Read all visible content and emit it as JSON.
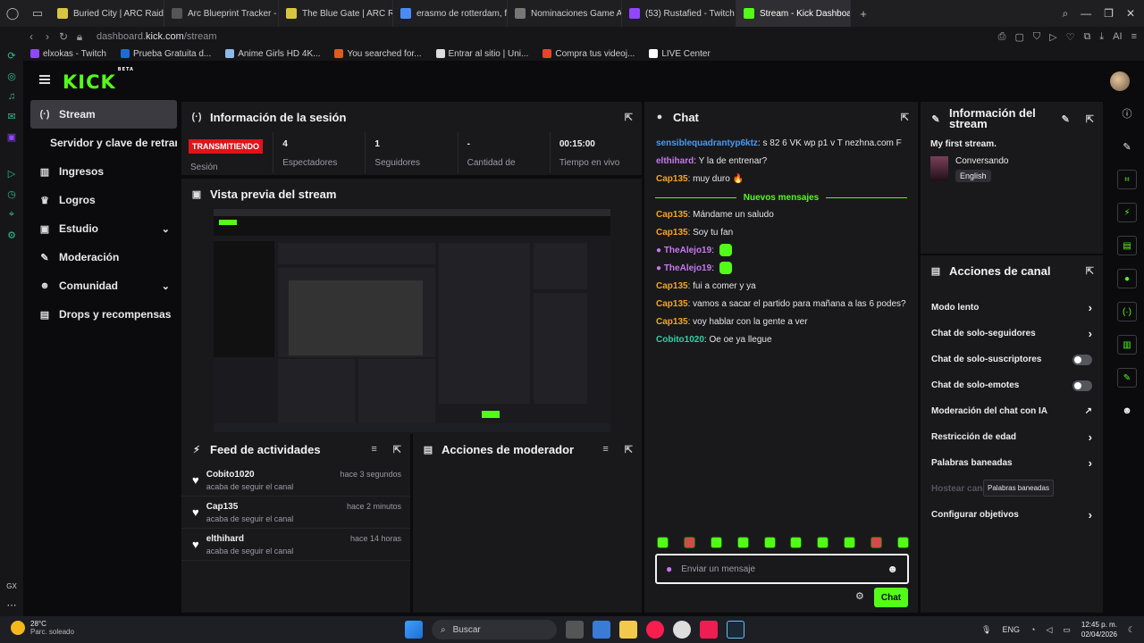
{
  "browser": {
    "tabs": [
      {
        "label": "Buried City | ARC Raiders",
        "color": "#d9c441"
      },
      {
        "label": "Arc Blueprint Tracker - Tra",
        "color": "#555"
      },
      {
        "label": "The Blue Gate | ARC Raide",
        "color": "#d9c441"
      },
      {
        "label": "erasmo de rotterdam, fras",
        "color": "#4a8cf5"
      },
      {
        "label": "Nominaciones Game Awa",
        "color": "#777"
      },
      {
        "label": "(53) Rustafied - Twitch",
        "color": "#9146ff"
      },
      {
        "label": "Stream - Kick Dashboard",
        "color": "#53fc18"
      }
    ],
    "url_prefix": "dashboard.",
    "url_domain": "kick.com",
    "url_path": "/stream",
    "bookmarks": [
      {
        "label": "elxokas - Twitch",
        "color": "#9146ff"
      },
      {
        "label": "Prueba Gratuita d...",
        "color": "#1c6bd9"
      },
      {
        "label": "Anime Girls HD 4K...",
        "color": "#8fb9e8"
      },
      {
        "label": "You searched for...",
        "color": "#e05a1f"
      },
      {
        "label": "Entrar al sitio | Uni...",
        "color": "#ddd"
      },
      {
        "label": "Compra tus videoj...",
        "color": "#e9432c"
      },
      {
        "label": "LIVE Center",
        "color": "#fff"
      }
    ]
  },
  "app": {
    "logo": "KICK",
    "logo_badge": "BETA",
    "nav": [
      {
        "label": "Stream",
        "icon": "broadcast-icon",
        "glyph": "(·)"
      },
      {
        "label": "Servidor y clave de retransmisión",
        "icon": "",
        "glyph": ""
      },
      {
        "label": "Ingresos",
        "icon": "chart-icon",
        "glyph": "▥"
      },
      {
        "label": "Logros",
        "icon": "trophy-icon",
        "glyph": "♛"
      },
      {
        "label": "Estudio",
        "icon": "studio-icon",
        "glyph": "▣"
      },
      {
        "label": "Moderación",
        "icon": "wrench-icon",
        "glyph": "✎"
      },
      {
        "label": "Comunidad",
        "icon": "people-icon",
        "glyph": "☻"
      },
      {
        "label": "Drops y recompensas",
        "icon": "gift-icon",
        "glyph": "▤"
      }
    ]
  },
  "session": {
    "title": "Información de la sesión",
    "live_badge": "TRANSMITIENDO",
    "stats": [
      {
        "value": "",
        "label": "Sesión"
      },
      {
        "value": "4",
        "label": "Espectadores"
      },
      {
        "value": "1",
        "label": "Seguidores"
      },
      {
        "value": "-",
        "label": "Cantidad de"
      },
      {
        "value": "00:15:00",
        "label": "Tiempo en vivo"
      }
    ]
  },
  "preview": {
    "title": "Vista previa del stream"
  },
  "feed": {
    "title": "Feed de actividades",
    "items": [
      {
        "name": "Cobito1020",
        "sub": "acaba de seguir el canal",
        "time": "hace 3 segundos"
      },
      {
        "name": "Cap135",
        "sub": "acaba de seguir el canal",
        "time": "hace 2 minutos"
      },
      {
        "name": "elthihard",
        "sub": "acaba de seguir el canal",
        "time": "hace 14 horas"
      }
    ]
  },
  "moderator": {
    "title": "Acciones de moderador"
  },
  "chat": {
    "title": "Chat",
    "messages_before": [
      {
        "user": "sensiblequadrantyp6ktz",
        "text": ": s 82 6 VK wp p1 v T nezhna.com F",
        "color": "#4a9bf0"
      },
      {
        "user": "elthihard",
        "text": ": Y la de entrenar?",
        "color": "#c678f0"
      },
      {
        "user": "Cap135",
        "text": ": muy duro 🔥",
        "color": "#f5a623"
      }
    ],
    "new_label": "Nuevos mensajes",
    "messages_after": [
      {
        "user": "Cap135",
        "text": ": Mándame un saludo",
        "color": "#f5a623"
      },
      {
        "user": "Cap135",
        "text": ": Soy tu fan",
        "color": "#f5a623"
      },
      {
        "user": "TheAlejo19",
        "text": ":",
        "color": "#c678f0",
        "emote": true
      },
      {
        "user": "TheAlejo19",
        "text": ":",
        "color": "#c678f0",
        "emote": true
      },
      {
        "user": "Cap135",
        "text": ": fui a comer y ya",
        "color": "#f5a623"
      },
      {
        "user": "Cap135",
        "text": ": vamos a sacar el partido para mañana a las 6 podes?",
        "color": "#f5a623"
      },
      {
        "user": "Cap135",
        "text": ": voy hablar con la gente a ver",
        "color": "#f5a623"
      },
      {
        "user": "Cobito1020",
        "text": ": Oe oe ya llegue",
        "color": "#2fd3a3"
      }
    ],
    "input_placeholder": "Enviar un mensaje",
    "send_label": "Chat"
  },
  "info": {
    "title": "Información del stream",
    "stream_title": "My first stream.",
    "category": "Conversando",
    "language": "English"
  },
  "actions": {
    "title": "Acciones de canal",
    "items": [
      {
        "label": "Modo lento",
        "type": "arrow"
      },
      {
        "label": "Chat de solo-seguidores",
        "type": "arrow"
      },
      {
        "label": "Chat de solo-suscriptores",
        "type": "toggle"
      },
      {
        "label": "Chat de solo-emotes",
        "type": "toggle"
      },
      {
        "label": "Moderación del chat con IA",
        "type": "external"
      },
      {
        "label": "Restricción de edad",
        "type": "arrow"
      },
      {
        "label": "Palabras baneadas",
        "type": "arrow"
      },
      {
        "label": "Hostear canal",
        "type": "dim"
      },
      {
        "label": "Configurar objetivos",
        "type": "arrow"
      }
    ],
    "tooltip": "Palabras baneadas"
  },
  "taskbar": {
    "temp": "28°C",
    "weather": "Parc. soleado",
    "search": "Buscar",
    "lang": "ENG",
    "time": "12:45 p. m.",
    "date": "02/04/2026"
  }
}
